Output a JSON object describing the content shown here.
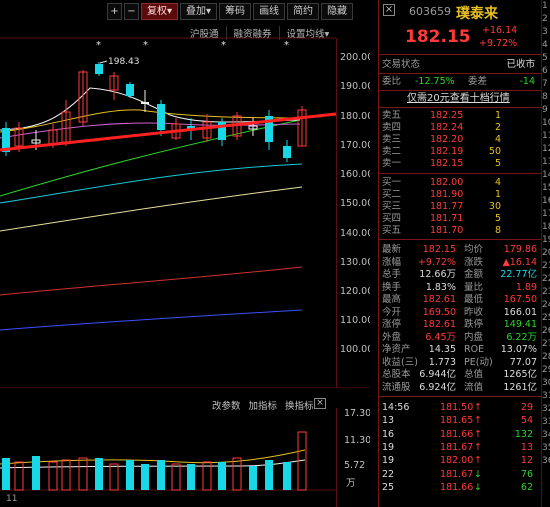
{
  "toolbar": {
    "plus": "+",
    "minus": "−",
    "buttons": [
      "复权▾",
      "叠加▾",
      "筹码",
      "画线",
      "简约",
      "隐藏"
    ]
  },
  "subtoolbar": [
    "沪股通",
    "融资融券",
    "设置均线▾"
  ],
  "kline": {
    "high_label": "198.43",
    "price_axis": [
      "200.00",
      "190.00",
      "180.00",
      "170.00",
      "160.00",
      "150.00",
      "140.00",
      "130.00",
      "120.00",
      "110.00",
      "100.00"
    ]
  },
  "volume": {
    "tools": [
      "改参数",
      "加指标",
      "换指标"
    ],
    "axis": [
      "17.30",
      "11.30",
      "5.72",
      "万"
    ],
    "bottom_label": "11"
  },
  "stock": {
    "code": "603659",
    "name": "璞泰来",
    "price": "182.15",
    "change": "+16.14",
    "change_pct": "+9.72%",
    "trade_status_label": "交易状态",
    "trade_status": "已收市",
    "weibi_label": "委比",
    "weibi": "-12.75%",
    "weicha_label": "委差",
    "weicha": "-14",
    "promo": "仅需20元查看十档行情"
  },
  "asks": [
    {
      "label": "卖五",
      "price": "182.25",
      "vol": "1"
    },
    {
      "label": "卖四",
      "price": "182.24",
      "vol": "2"
    },
    {
      "label": "卖三",
      "price": "182.20",
      "vol": "4"
    },
    {
      "label": "卖二",
      "price": "182.19",
      "vol": "50"
    },
    {
      "label": "卖一",
      "price": "182.15",
      "vol": "5"
    }
  ],
  "bids": [
    {
      "label": "买一",
      "price": "182.00",
      "vol": "4"
    },
    {
      "label": "买二",
      "price": "181.90",
      "vol": "1"
    },
    {
      "label": "买三",
      "price": "181.77",
      "vol": "30"
    },
    {
      "label": "买四",
      "price": "181.71",
      "vol": "5"
    },
    {
      "label": "买五",
      "price": "181.70",
      "vol": "8"
    }
  ],
  "stats": [
    {
      "l1": "最新",
      "v1": "182.15",
      "c1": "red",
      "l2": "均价",
      "v2": "179.86",
      "c2": "red"
    },
    {
      "l1": "涨幅",
      "v1": "+9.72%",
      "c1": "red",
      "l2": "涨跌",
      "v2": "▲16.14",
      "c2": "red"
    },
    {
      "l1": "总手",
      "v1": "12.66万",
      "c1": "white",
      "l2": "金额",
      "v2": "22.77亿",
      "c2": "cyan"
    },
    {
      "l1": "换手",
      "v1": "1.83%",
      "c1": "white",
      "l2": "量比",
      "v2": "1.89",
      "c2": "red"
    },
    {
      "l1": "最高",
      "v1": "182.61",
      "c1": "red",
      "l2": "最低",
      "v2": "167.50",
      "c2": "red"
    },
    {
      "l1": "今开",
      "v1": "169.50",
      "c1": "red",
      "l2": "昨收",
      "v2": "166.01",
      "c2": "white"
    },
    {
      "l1": "涨停",
      "v1": "182.61",
      "c1": "red",
      "l2": "跌停",
      "v2": "149.41",
      "c2": "green"
    },
    {
      "l1": "外盘",
      "v1": "6.45万",
      "c1": "red",
      "l2": "内盘",
      "v2": "6.22万",
      "c2": "green"
    },
    {
      "l1": "净资产",
      "v1": "14.35",
      "c1": "white",
      "l2": "ROE",
      "v2": "13.07%",
      "c2": "white"
    },
    {
      "l1": "收益(三)",
      "v1": "1.773",
      "c1": "white",
      "l2": "PE(动)",
      "v2": "77.07",
      "c2": "white"
    },
    {
      "l1": "总股本",
      "v1": "6.944亿",
      "c1": "white",
      "l2": "总值",
      "v2": "1265亿",
      "c2": "white"
    },
    {
      "l1": "流通股",
      "v1": "6.924亿",
      "c1": "white",
      "l2": "流值",
      "v2": "1261亿",
      "c2": "white"
    }
  ],
  "ticks": [
    {
      "time": "14:56",
      "price": "181.50",
      "dir": "↑",
      "vol": "29",
      "vc": "red"
    },
    {
      "time": "13",
      "price": "181.65",
      "dir": "↑",
      "vol": "54",
      "vc": "red"
    },
    {
      "time": "16",
      "price": "181.66",
      "dir": "↑",
      "vol": "132",
      "vc": "green"
    },
    {
      "time": "19",
      "price": "181.67",
      "dir": "↑",
      "vol": "13",
      "vc": "red"
    },
    {
      "time": "19",
      "price": "182.00",
      "dir": "↑",
      "vol": "12",
      "vc": "red"
    },
    {
      "time": "22",
      "price": "181.67",
      "dir": "↓",
      "vol": "76",
      "vc": "green"
    },
    {
      "time": "25",
      "price": "181.66",
      "dir": "↓",
      "vol": "62",
      "vc": "green"
    }
  ],
  "far_strip": [
    "1",
    "2",
    "3",
    "4",
    "5",
    "6",
    "7",
    "8",
    "9",
    "10",
    "11",
    "12",
    "13",
    "14",
    "15",
    "16",
    "17",
    "18",
    "19",
    "20",
    "21",
    "22",
    "23",
    "24",
    "25",
    "26",
    "27",
    "28",
    "29",
    "30",
    "31",
    "32",
    "33",
    "34",
    "35",
    "36"
  ],
  "colors": {
    "up": "#ff3a3a",
    "down": "#29d629",
    "cyan": "#18d8e8",
    "border": "#7a1414"
  }
}
